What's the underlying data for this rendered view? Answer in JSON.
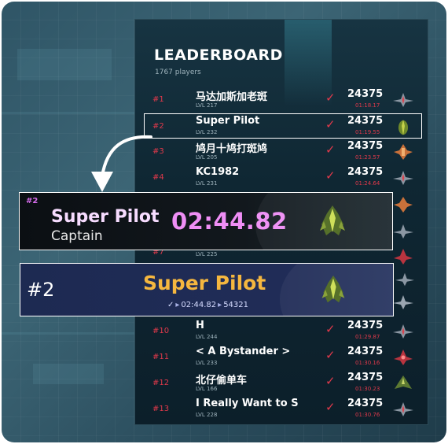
{
  "leaderboard": {
    "title": "LEADERBOARD",
    "player_count": "1767 players",
    "rows": [
      {
        "rank": "#1",
        "name": "马达加斯加老斑",
        "level": "LVL 217",
        "score": "24375",
        "time": "01:18.17",
        "ship": "fighter-ship-icon"
      },
      {
        "rank": "#2",
        "name": "Super Pilot",
        "level": "LVL 232",
        "score": "24375",
        "time": "01:19.55",
        "ship": "beetle-ship-icon"
      },
      {
        "rank": "#3",
        "name": "鸠月十鸠打斑鸠",
        "level": "LVL 205",
        "score": "24375",
        "time": "01:23.57",
        "ship": "orange-ship-icon"
      },
      {
        "rank": "#4",
        "name": "KC1982",
        "level": "LVL 231",
        "score": "24375",
        "time": "01:24.64",
        "ship": "fighter-ship-icon"
      },
      {
        "rank": "#10",
        "name": "H",
        "level": "LVL 244",
        "score": "24375",
        "time": "01:29.87",
        "ship": "fighter-ship-icon"
      },
      {
        "rank": "#11",
        "name": "< A Bystander >",
        "level": "LVL 233",
        "score": "24375",
        "time": "01:30.16",
        "ship": "red-ship-icon"
      },
      {
        "rank": "#12",
        "name": "北仔偷单车",
        "level": "LVL 166",
        "score": "24375",
        "time": "01:30.23",
        "ship": "green-ship-icon"
      },
      {
        "rank": "#13",
        "name": "I Really Want to S",
        "level": "LVL 228",
        "score": "24375",
        "time": "01:30.76",
        "ship": "fighter-ship-icon"
      }
    ],
    "partial_row": {
      "rank": "#7",
      "level": "LVL 225"
    }
  },
  "card_one": {
    "rank": "#2",
    "name": "Super Pilot",
    "title": "Captain",
    "time": "02:44.82",
    "ship": "beetle-ship-icon"
  },
  "card_two": {
    "rank": "#2",
    "name": "Super Pilot",
    "check": "✓",
    "time": "02:44.82",
    "score": "54321",
    "ship": "beetle-ship-icon"
  },
  "colors": {
    "accent_red": "#e0394b",
    "pink_time": "#ef8ef5",
    "gold_name": "#f5b73f"
  }
}
